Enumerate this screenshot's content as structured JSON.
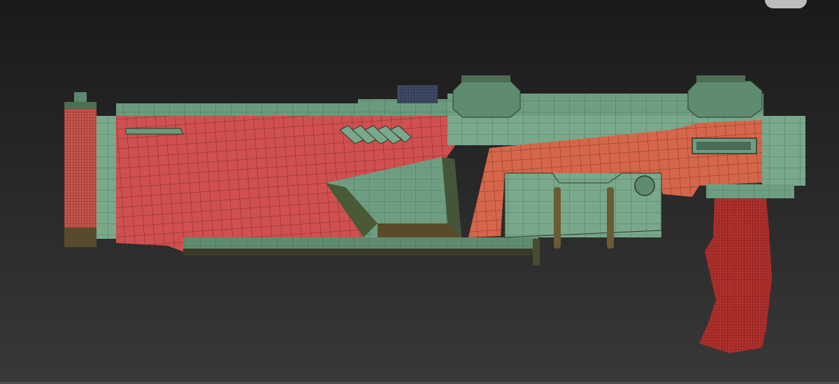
{
  "viewport": {
    "background_top": "#1a1a1a",
    "background_bottom": "#383838",
    "viewcube_icon": "viewcube-corner-icon"
  },
  "model": {
    "name": "",
    "colors": {
      "green_face": "#6e9e82",
      "green_dark": "#4f7a62",
      "red_face": "#d0504f",
      "orange_face": "#d6664a",
      "grip_red": "#b3302c",
      "edge_shadow": "#3a3a24",
      "wire": "#2a1e16"
    }
  }
}
